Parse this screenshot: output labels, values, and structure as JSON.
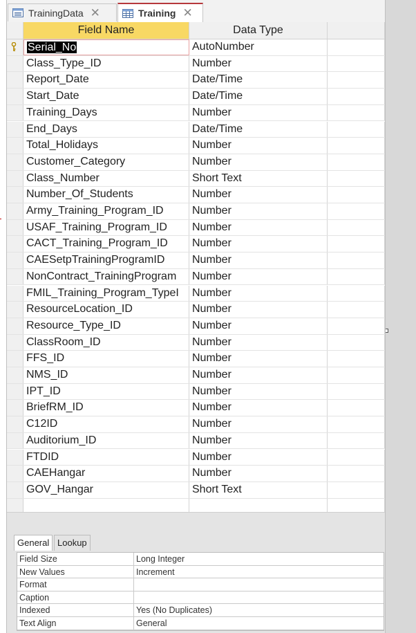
{
  "tabs": [
    {
      "label": "TrainingData",
      "icon": "form-icon",
      "active": false
    },
    {
      "label": "Training",
      "icon": "table-icon",
      "active": true
    }
  ],
  "grid": {
    "headers": {
      "field_name": "Field Name",
      "data_type": "Data Type",
      "description": ""
    },
    "rows": [
      {
        "field": "Serial_No",
        "type": "AutoNumber",
        "key": true
      },
      {
        "field": "Class_Type_ID",
        "type": "Number"
      },
      {
        "field": "Report_Date",
        "type": "Date/Time"
      },
      {
        "field": "Start_Date",
        "type": "Date/Time"
      },
      {
        "field": "Training_Days",
        "type": "Number"
      },
      {
        "field": "End_Days",
        "type": "Date/Time"
      },
      {
        "field": "Total_Holidays",
        "type": "Number"
      },
      {
        "field": "Customer_Category",
        "type": "Number"
      },
      {
        "field": "Class_Number",
        "type": "Short Text"
      },
      {
        "field": "Number_Of_Students",
        "type": "Number"
      },
      {
        "field": "Army_Training_Program_ID",
        "type": "Number"
      },
      {
        "field": "USAF_Training_Program_ID",
        "type": "Number"
      },
      {
        "field": "CACT_Training_Program_ID",
        "type": "Number"
      },
      {
        "field": "CAESetpTrainingProgramID",
        "type": "Number"
      },
      {
        "field": "NonContract_TrainingProgram",
        "type": "Number"
      },
      {
        "field": "FMIL_Training_Program_TypeI",
        "type": "Number"
      },
      {
        "field": "ResourceLocation_ID",
        "type": "Number"
      },
      {
        "field": "Resource_Type_ID",
        "type": "Number"
      },
      {
        "field": "ClassRoom_ID",
        "type": "Number"
      },
      {
        "field": "FFS_ID",
        "type": "Number"
      },
      {
        "field": "NMS_ID",
        "type": "Number"
      },
      {
        "field": "IPT_ID",
        "type": "Number"
      },
      {
        "field": "BriefRM_ID",
        "type": "Number"
      },
      {
        "field": "C12ID",
        "type": "Number"
      },
      {
        "field": "Auditorium_ID",
        "type": "Number"
      },
      {
        "field": "FTDID",
        "type": "Number"
      },
      {
        "field": "CAEHangar",
        "type": "Number"
      },
      {
        "field": "GOV_Hangar",
        "type": "Short Text"
      },
      {
        "field": "",
        "type": ""
      }
    ]
  },
  "properties": {
    "tabs": [
      "General",
      "Lookup"
    ],
    "rows": [
      {
        "key": "Field Size",
        "value": "Long Integer"
      },
      {
        "key": "New Values",
        "value": "Increment"
      },
      {
        "key": "Format",
        "value": ""
      },
      {
        "key": "Caption",
        "value": ""
      },
      {
        "key": "Indexed",
        "value": "Yes (No Duplicates)"
      },
      {
        "key": "Text Align",
        "value": "General"
      }
    ]
  },
  "colors": {
    "selected_header": "#f8d864",
    "active_tab_accent": "#b6373b"
  }
}
